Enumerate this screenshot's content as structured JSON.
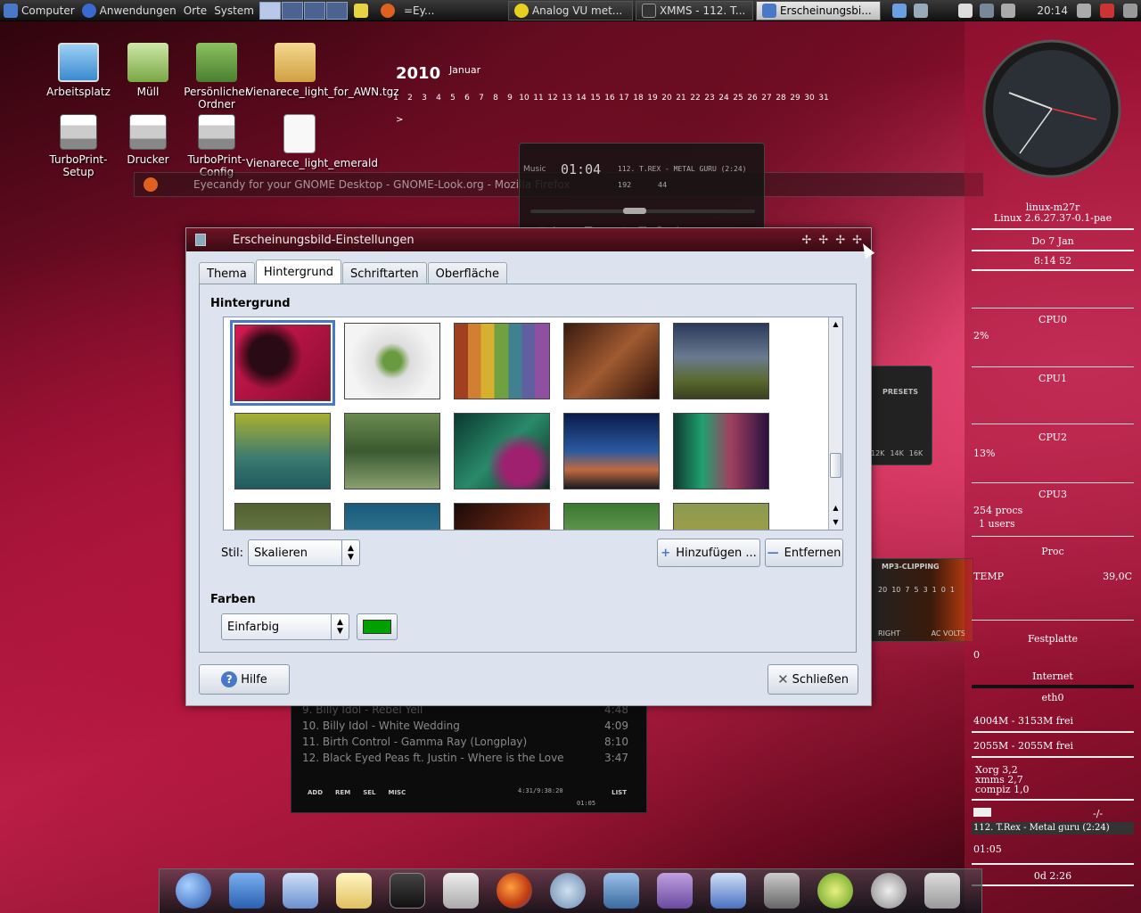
{
  "top_panel": {
    "computer": "Computer",
    "applications": "Anwendungen",
    "places": "Orte",
    "system": "System",
    "tasks": [
      "=Ey...",
      "Analog VU met...",
      "XMMS - 112. T...",
      "Erscheinungsbi..."
    ],
    "clock": "20:14"
  },
  "desktop_icons": [
    {
      "label": "Arbeitsplatz"
    },
    {
      "label": "Müll"
    },
    {
      "label": "Persönlicher Ordner"
    },
    {
      "label": "Vienarece_light_for_AWN.tgz"
    },
    {
      "label": "TurboPrint-Setup"
    },
    {
      "label": "Drucker"
    },
    {
      "label": "TurboPrint-Config"
    },
    {
      "label": "Vienarece_light_emerald"
    }
  ],
  "calendar": {
    "year": "2010",
    "month": "Januar",
    "days": [
      "1",
      "2",
      "3",
      "4",
      "5",
      "6",
      "7",
      "8",
      "9",
      "10",
      "11",
      "12",
      "13",
      "14",
      "15",
      "16",
      "17",
      "18",
      "19",
      "20",
      "21",
      "22",
      "23",
      "24",
      "25",
      "26",
      "27",
      "28",
      "29",
      "30",
      "31"
    ],
    "next": ">"
  },
  "firefox_bar": {
    "title": "Eyecandy for your GNOME Desktop - GNOME-Look.org - Mozilla Firefox"
  },
  "player": {
    "label": "Music",
    "time": "01:04",
    "track": "112. T.REX - METAL GURU (2:24)",
    "kbps": "192",
    "khz": "44"
  },
  "playlist": {
    "rows": [
      {
        "title": "9. Billy Idol - Rebel Yell",
        "time": "4:48"
      },
      {
        "title": "10. Billy Idol - White Wedding",
        "time": "4:09"
      },
      {
        "title": "11. Birth Control - Gamma Ray (Longplay)",
        "time": "8:10"
      },
      {
        "title": "12. Black Eyed Peas ft. Justin - Where is the Love",
        "time": "3:47"
      }
    ],
    "buttons": [
      "ADD",
      "REM",
      "SEL",
      "MISC"
    ],
    "total": "4:31/9:38:20",
    "elapsed": "01:05",
    "list": "LIST"
  },
  "equalizer": {
    "presets": "PRESETS",
    "bands": [
      "12K",
      "14K",
      "16K"
    ]
  },
  "vu_meter": {
    "title": "MP3-CLIPPING",
    "scale": [
      "20",
      "10",
      "7",
      "5",
      "3",
      "1",
      "0",
      "1"
    ],
    "right": "RIGHT",
    "ac_volts": "AC VOLTS"
  },
  "dialog": {
    "title": "Erscheinungsbild-Einstellungen",
    "tabs": [
      "Thema",
      "Hintergrund",
      "Schriftarten",
      "Oberfläche"
    ],
    "active_tab": "Hintergrund",
    "section_background": "Hintergrund",
    "style_label": "Stil:",
    "style_value": "Skalieren",
    "add_button": "Hinzufügen ...",
    "remove_button": "Entfernen",
    "section_colors": "Farben",
    "color_mode": "Einfarbig",
    "color_value": "#00a000",
    "help_button": "Hilfe",
    "close_button": "Schließen"
  },
  "conky": {
    "hostname": "linux-m27r",
    "kernel": "Linux 2.6.27.37-0.1-pae",
    "date": "Do  7 Jan",
    "time": "8:14 52",
    "cpu0": "CPU0",
    "cpu0_pct": "2%",
    "cpu1": "CPU1",
    "cpu2": "CPU2",
    "cpu2_pct": "13%",
    "cpu3": "CPU3",
    "procs": "254 procs",
    "users": "1 users",
    "proc": "Proc",
    "temp_label": "TEMP",
    "temp_value": "39,0C",
    "disk": "Festplatte",
    "disk_value": "0",
    "internet": "Internet",
    "eth": "eth0",
    "mem1": "4004M - 3153M frei",
    "mem2": "2055M - 2055M frei",
    "top1": "Xorg  3,2",
    "top2": "xmms  2,7",
    "top3": "compiz  1,0",
    "mail": "-/-",
    "now_playing": "112. T.Rex - Metal guru (2:24)",
    "np_time": "01:05",
    "uptime": "0d  2:26"
  },
  "colors": {
    "accent": "#4a78c8",
    "wallpaper_pink": "#c4254f"
  },
  "icons": {
    "dock": [
      "globe-icon",
      "home-icon",
      "mail-icon",
      "notes-icon",
      "terminal-icon",
      "settings-icon",
      "firefox-icon",
      "music-icon",
      "network-icon",
      "office-icon",
      "writer-icon",
      "gimp-icon",
      "lime-icon",
      "media-icon",
      "trash-icon"
    ]
  }
}
